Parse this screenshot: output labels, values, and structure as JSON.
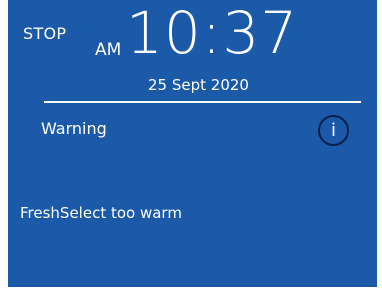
{
  "status": {
    "mode": "STOP"
  },
  "clock": {
    "ampm": "AM",
    "time": "10:37",
    "date": "25  Sept 2020"
  },
  "alert": {
    "title": "Warning",
    "info_glyph": "i",
    "message": "FreshSelect too warm"
  },
  "icons": {
    "info": "info-circle-icon"
  },
  "colors": {
    "background": "#1b5aa8",
    "text": "#ffffff",
    "icon_ring": "#0a1f4a"
  }
}
